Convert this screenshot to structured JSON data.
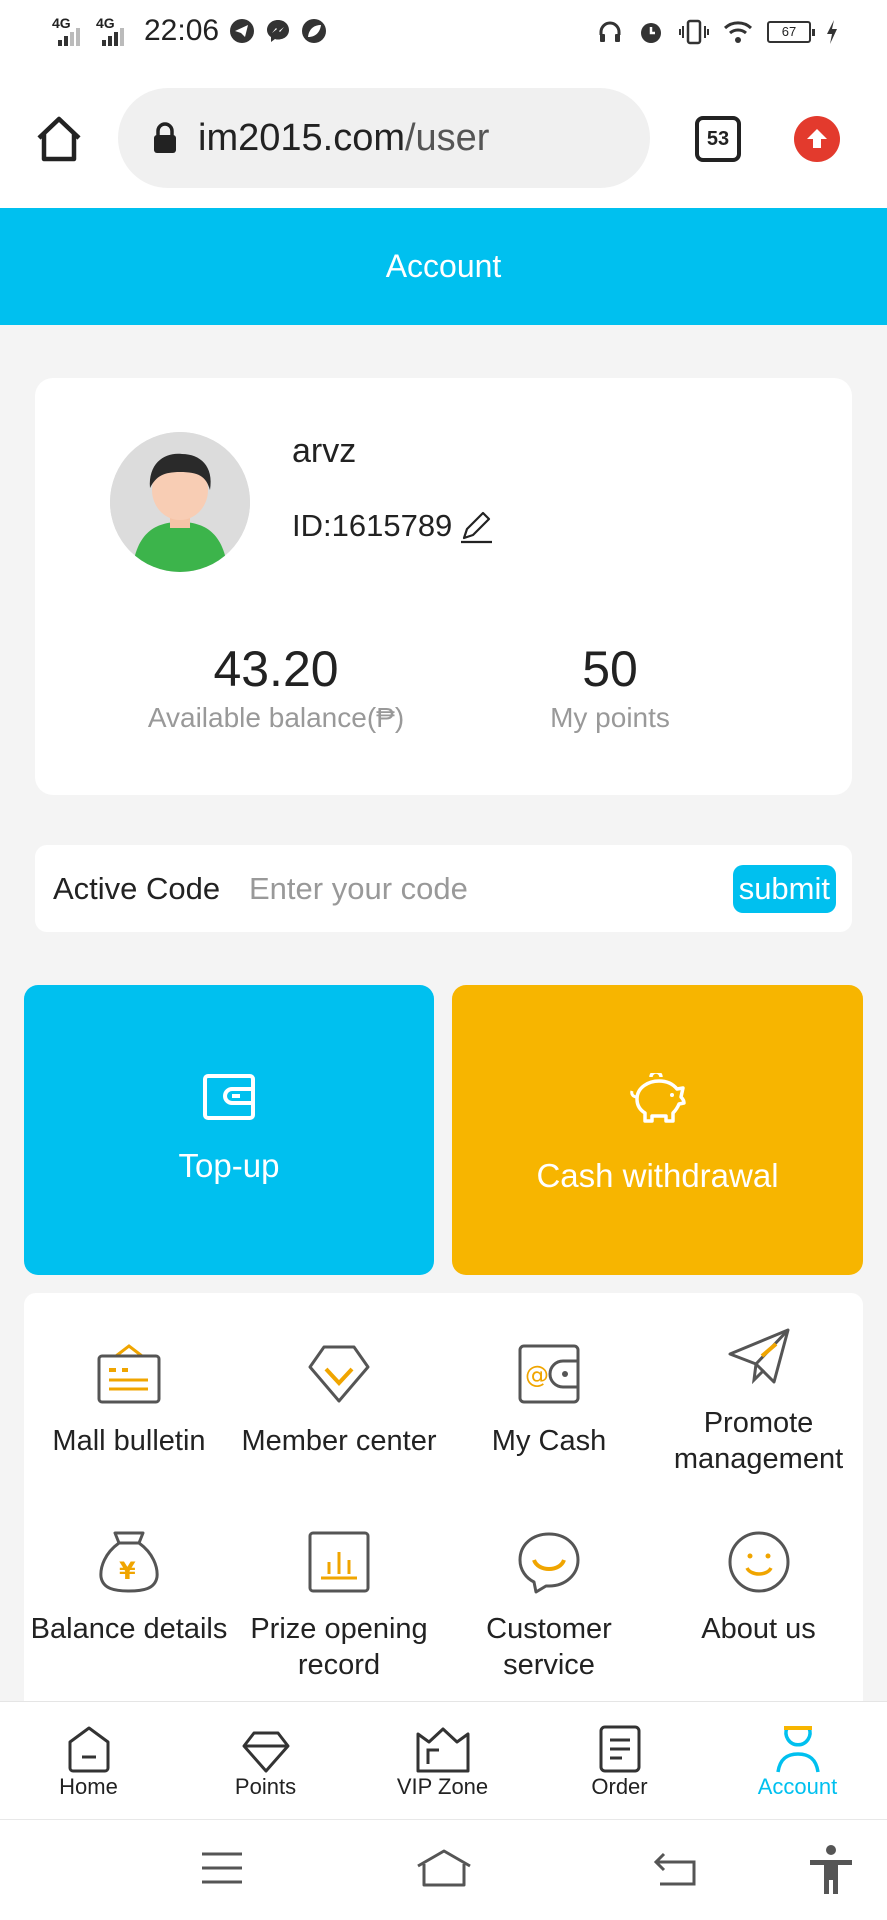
{
  "status_bar": {
    "network1": "4G",
    "network2": "4G",
    "time": "22:06",
    "battery": "67"
  },
  "browser": {
    "url_host": "im2015.com",
    "url_path": "/user",
    "tab_count": "53"
  },
  "header": {
    "title": "Account"
  },
  "profile": {
    "username": "arvz",
    "id": "ID:1615789",
    "balance_value": "43.20",
    "balance_label": "Available balance(₱)",
    "points_value": "50",
    "points_label": "My points"
  },
  "active_code": {
    "label": "Active Code",
    "placeholder": "Enter your code",
    "submit_label": "submit"
  },
  "tiles": {
    "topup_label": "Top-up",
    "withdraw_label": "Cash withdrawal"
  },
  "menu": {
    "mall_bulletin": "Mall bulletin",
    "member_center": "Member center",
    "my_cash": "My Cash",
    "promote_management": "Promote management",
    "balance_details": "Balance details",
    "prize_opening_record": "Prize opening record",
    "customer_service": "Customer service",
    "about_us": "About us"
  },
  "tabbar": {
    "home": "Home",
    "points": "Points",
    "vip_zone": "VIP Zone",
    "order": "Order",
    "account": "Account"
  },
  "colors": {
    "accent": "#00c0ef",
    "withdraw": "#f7b500",
    "icon_orange": "#f0a500",
    "up_button": "#e33a2d"
  }
}
